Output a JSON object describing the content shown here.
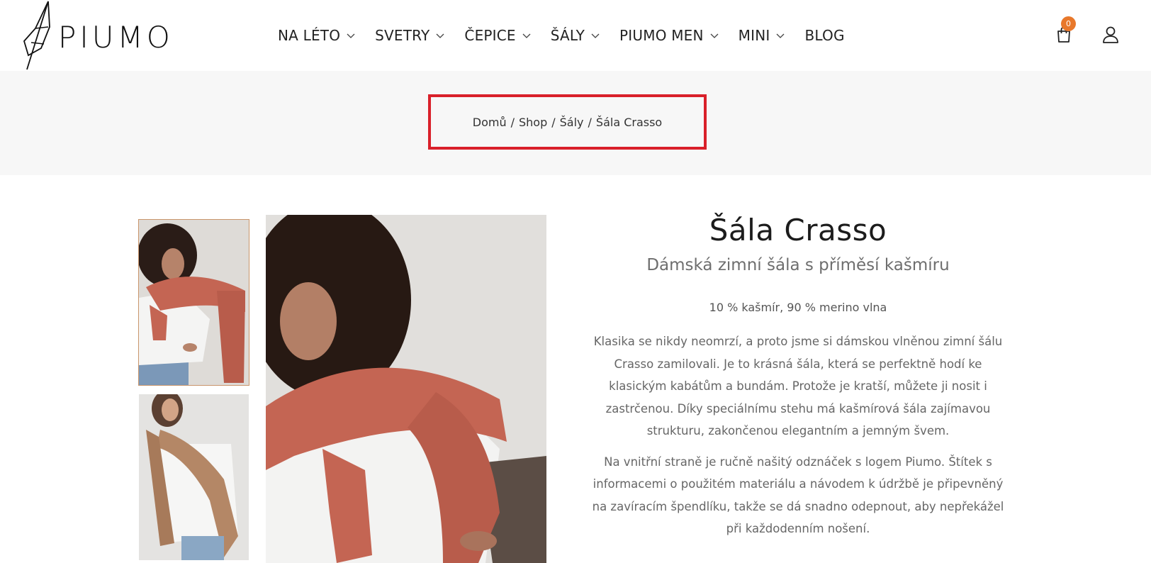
{
  "brand": {
    "name": "PIUMO",
    "accent": "#e8782b"
  },
  "nav": {
    "items": [
      {
        "label": "NA LÉTO",
        "has_dropdown": true
      },
      {
        "label": "SVETRY",
        "has_dropdown": true
      },
      {
        "label": "ČEPICE",
        "has_dropdown": true
      },
      {
        "label": "ŠÁLY",
        "has_dropdown": true
      },
      {
        "label": "PIUMO MEN",
        "has_dropdown": true
      },
      {
        "label": "MINI",
        "has_dropdown": true
      },
      {
        "label": "BLOG",
        "has_dropdown": false
      }
    ]
  },
  "header": {
    "cart_count": "0",
    "cart_icon": "shopping-bag-icon",
    "account_icon": "user-icon"
  },
  "breadcrumb": {
    "items": [
      "Domů",
      "Shop",
      "Šály",
      "Šála Crasso"
    ],
    "separator": "/",
    "highlight_color": "#d9202a"
  },
  "product": {
    "title": "Šála Crasso",
    "subtitle": "Dámská zimní šála s příměsí kašmíru",
    "composition": "10 % kašmír, 90 % merino vlna",
    "description": [
      "Klasika se nikdy neomrzí, a proto jsme si dámskou vlněnou zimní šálu Crasso zamilovali. Je to krásná šála, která se perfektně hodí ke klasickým kabátům a bundám. Protože je kratší, můžete ji nosit i zastrčenou. Díky speciálnímu stehu má kašmírová šála zajímavou strukturu, zakončenou elegantním a jemným švem.",
      "Na vnitřní straně je ručně našitý odznáček s logem Piumo. Štítek s informacemi o použitém materiálu a návodem k údržbě je připevněný na zavíracím špendlíku, takže se dá snadno odepnout, aby nepřekážel při každodenním nošení."
    ],
    "scarf_colors": [
      "#c46553",
      "#b48766"
    ]
  }
}
